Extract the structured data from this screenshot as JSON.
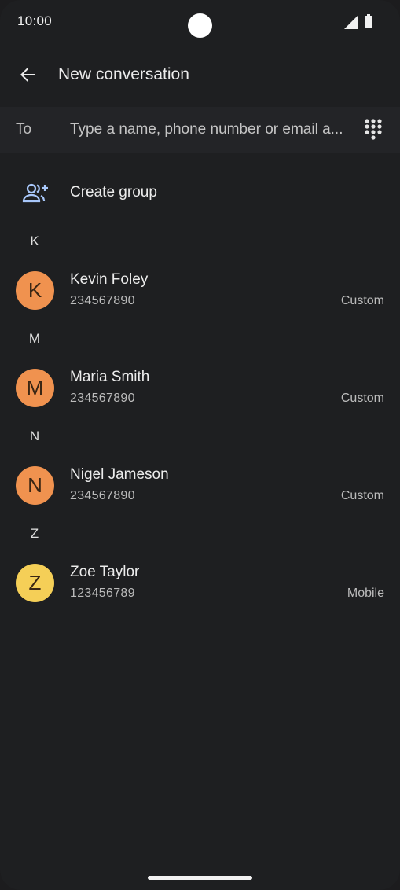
{
  "status_bar": {
    "time": "10:00",
    "icons": [
      "signal-icon",
      "battery-icon"
    ]
  },
  "app_bar": {
    "back_icon": "arrow-back-icon",
    "title": "New conversation"
  },
  "recipient": {
    "label": "To",
    "value": "",
    "placeholder": "Type a name, phone number or email a...",
    "dialpad_icon": "dialpad-icon"
  },
  "create_group": {
    "icon": "add-group-icon",
    "label": "Create group"
  },
  "sections": [
    {
      "letter": "K",
      "contacts": [
        {
          "initial": "K",
          "name": "Kevin Foley",
          "number": "234567890",
          "type": "Custom",
          "color": "#f0924f"
        }
      ]
    },
    {
      "letter": "M",
      "contacts": [
        {
          "initial": "M",
          "name": "Maria Smith",
          "number": "234567890",
          "type": "Custom",
          "color": "#f0924f"
        }
      ]
    },
    {
      "letter": "N",
      "contacts": [
        {
          "initial": "N",
          "name": "Nigel Jameson",
          "number": "234567890",
          "type": "Custom",
          "color": "#f0924f"
        }
      ]
    },
    {
      "letter": "Z",
      "contacts": [
        {
          "initial": "Z",
          "name": "Zoe Taylor",
          "number": "123456789",
          "type": "Mobile",
          "color": "#f5cf57"
        }
      ]
    }
  ],
  "colors": {
    "background": "#1e1f21",
    "input_row": "#232427",
    "accent_blue": "#a8c7fa",
    "avatar_orange": "#f0924f",
    "avatar_yellow": "#f5cf57"
  }
}
